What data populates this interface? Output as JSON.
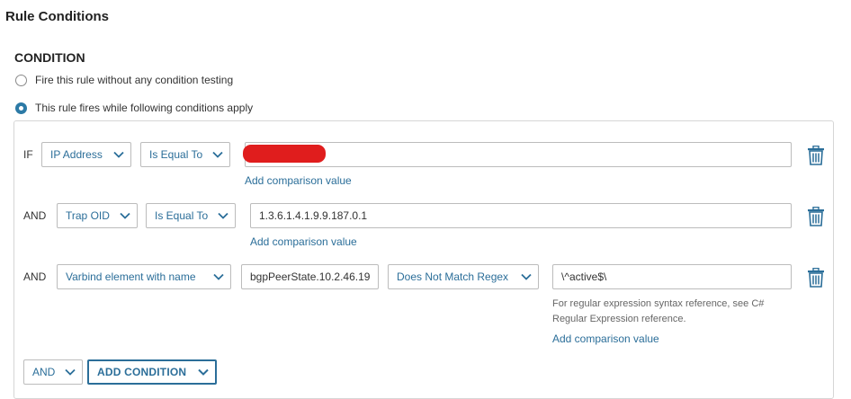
{
  "page": {
    "title": "Rule Conditions"
  },
  "condition": {
    "section_title": "CONDITION",
    "options": [
      {
        "label": "Fire this rule without any condition testing",
        "selected": false
      },
      {
        "label": "This rule fires while following conditions apply",
        "selected": true
      }
    ]
  },
  "rows": [
    {
      "keyword": "IF",
      "field": "IP Address",
      "operator": "Is Equal To",
      "value": "",
      "value_redacted": true,
      "add_link": "Add comparison value"
    },
    {
      "keyword": "AND",
      "field": "Trap OID",
      "operator": "Is Equal To",
      "value": "1.3.6.1.4.1.9.9.187.0.1",
      "add_link": "Add comparison value"
    },
    {
      "keyword": "AND",
      "field": "Varbind element with name",
      "varbind_name": "bgpPeerState.10.2.46.19",
      "operator": "Does Not Match Regex",
      "value": "\\^active$\\",
      "hint": "For regular expression syntax reference, see C# Regular Expression reference.",
      "add_link": "Add comparison value"
    }
  ],
  "footer": {
    "logic_select": "AND",
    "add_condition_label": "ADD CONDITION"
  },
  "colors": {
    "accent": "#2b6e99",
    "radio_selected": "#2c7aa6",
    "border": "#bcbcbc",
    "redaction": "#e01d1d"
  }
}
